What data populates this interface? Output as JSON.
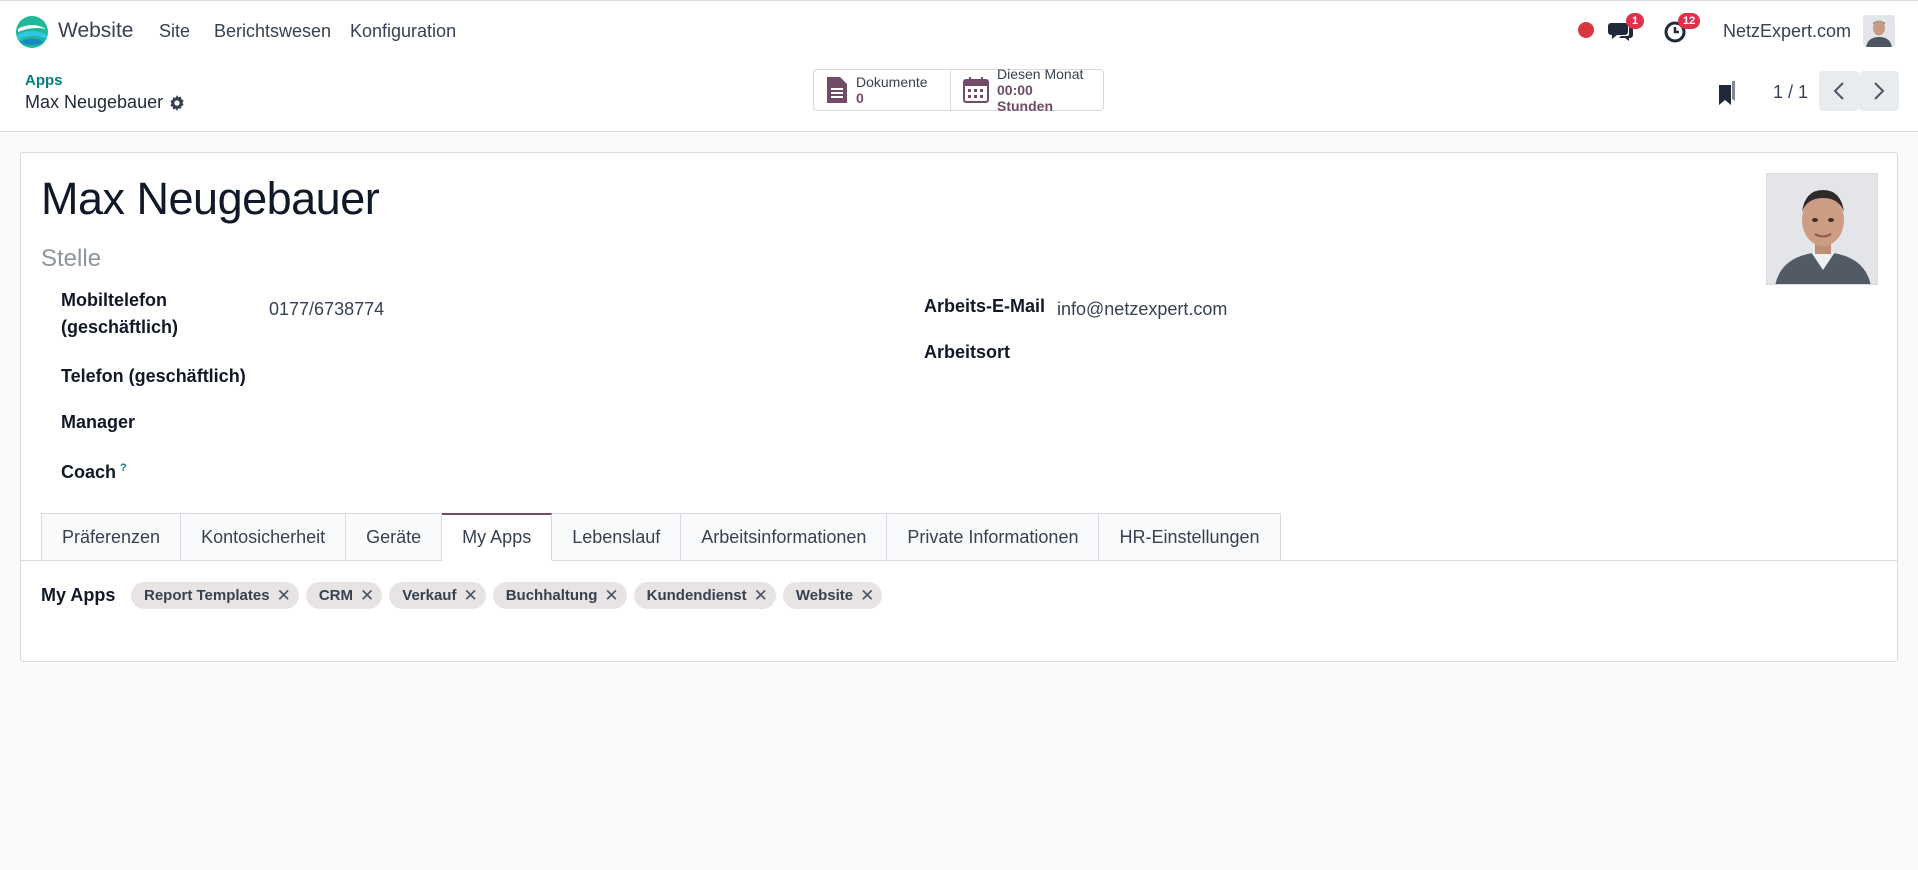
{
  "navbar": {
    "app_name": "Website",
    "menu": [
      "Site",
      "Berichtswesen",
      "Konfiguration"
    ],
    "messages_badge": "1",
    "activities_badge": "12",
    "company": "NetzExpert.com",
    "status_color": "#d9363e"
  },
  "control_panel": {
    "breadcrumb": "Apps",
    "record_title": "Max Neugebauer",
    "smart_documents_label": "Dokumente",
    "smart_documents_value": "0",
    "smart_month_label": "Diesen Monat",
    "smart_month_value": "00:00 Stunden",
    "pager": "1 / 1"
  },
  "form": {
    "name": "Max Neugebauer",
    "job_placeholder": "Stelle",
    "mobile_label_1": "Mobiltelefon",
    "mobile_label_2": "(geschäftlich)",
    "mobile_value": "0177/6738774",
    "phone_label": "Telefon (geschäftlich)",
    "manager_label": "Manager",
    "coach_label": "Coach",
    "coach_help": "?",
    "email_label": "Arbeits-E-Mail",
    "email_value": "info@netzexpert.com",
    "workplace_label": "Arbeitsort"
  },
  "tabs": [
    "Präferenzen",
    "Kontosicherheit",
    "Geräte",
    "My Apps",
    "Lebenslauf",
    "Arbeitsinformationen",
    "Private Informationen",
    "HR-Einstellungen"
  ],
  "active_tab": "My Apps",
  "my_apps": {
    "label": "My Apps",
    "tags": [
      "Report Templates",
      "CRM",
      "Verkauf",
      "Buchhaltung",
      "Kundendienst",
      "Website"
    ]
  },
  "colors": {
    "accent": "#714b67",
    "link": "#017e84",
    "badge": "#e0314b"
  }
}
